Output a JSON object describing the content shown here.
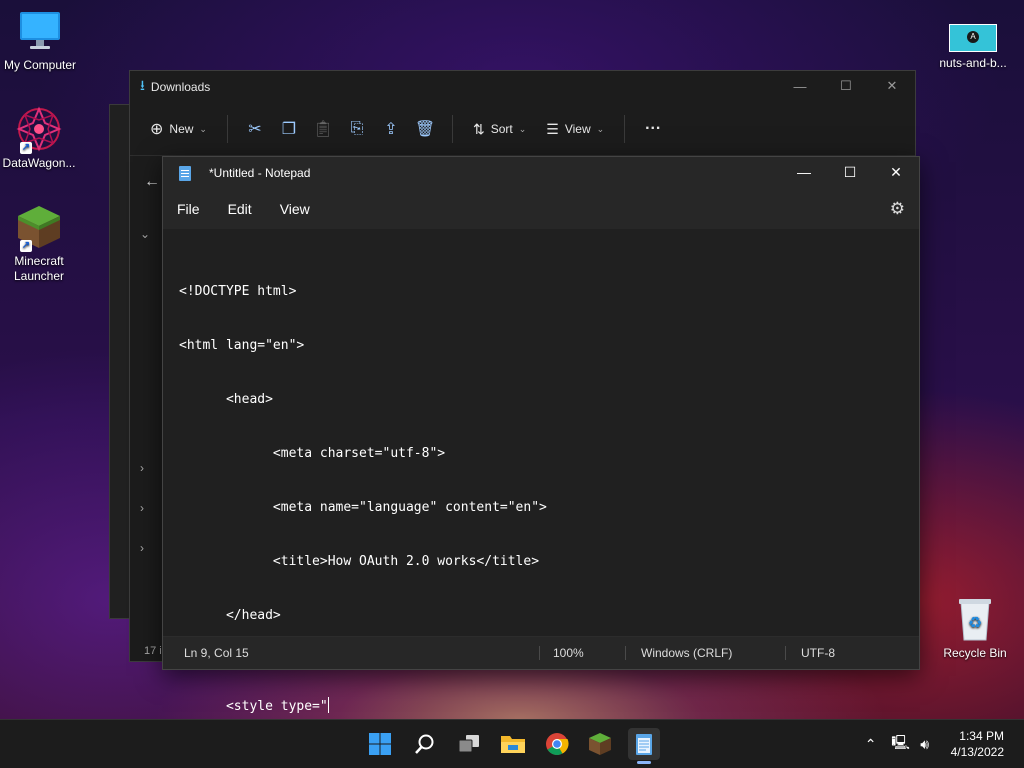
{
  "desktop": {
    "icons": [
      {
        "label": "My Computer",
        "icon": "monitor-icon"
      },
      {
        "label": "DataWagon...",
        "icon": "datawagon-icon"
      },
      {
        "label": "Minecraft Launcher",
        "icon": "minecraft-icon"
      },
      {
        "label": "nuts-and-b...",
        "icon": "image-thumbnail-icon"
      },
      {
        "label": "Recycle Bin",
        "icon": "recycle-bin-icon"
      }
    ]
  },
  "explorer": {
    "title": "Downloads",
    "toolbar": {
      "new_label": "New",
      "sort_label": "Sort",
      "view_label": "View"
    },
    "status": "17 i"
  },
  "notepad": {
    "title": "*Untitled - Notepad",
    "menu": [
      "File",
      "Edit",
      "View"
    ],
    "lines": [
      "<!DOCTYPE html>",
      "<html lang=\"en\">",
      "      <head>",
      "            <meta charset=\"utf-8\">",
      "            <meta name=\"language\" content=\"en\">",
      "            <title>How OAuth 2.0 works</title>",
      "      </head>",
      "",
      "      <style type=\""
    ],
    "status": {
      "position": "Ln 9, Col 15",
      "zoom": "100%",
      "line_ending": "Windows (CRLF)",
      "encoding": "UTF-8"
    }
  },
  "taskbar": {
    "time": "1:34 PM",
    "date": "4/13/2022"
  },
  "colors": {
    "accent": "#8ab4f8",
    "notepad_bg": "#202020",
    "taskbar_bg": "#1c1c1c"
  }
}
